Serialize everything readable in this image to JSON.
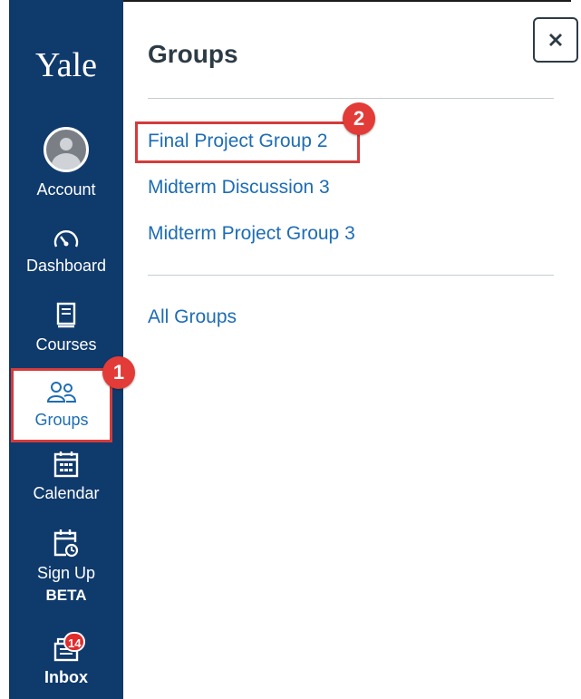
{
  "nav": {
    "logo": "Yale",
    "items": [
      {
        "label": "Account",
        "icon": "account-avatar-icon"
      },
      {
        "label": "Dashboard",
        "icon": "dashboard-icon"
      },
      {
        "label": "Courses",
        "icon": "courses-icon"
      },
      {
        "label": "Groups",
        "icon": "groups-icon",
        "active": true
      },
      {
        "label": "Calendar",
        "icon": "calendar-icon"
      },
      {
        "label_line1": "Sign Up",
        "label_line2": "BETA",
        "icon": "signup-clock-icon"
      },
      {
        "label": "Inbox",
        "icon": "inbox-icon",
        "badge": "14"
      }
    ]
  },
  "tray": {
    "title": "Groups",
    "links": [
      "Final Project Group 2",
      "Midterm Discussion 3",
      "Midterm Project Group 3"
    ],
    "all_link": "All Groups",
    "close_icon": "close-icon"
  },
  "callouts": {
    "step1": "1",
    "step2": "2"
  },
  "colors": {
    "nav_bg": "#0f3a6c",
    "link": "#1d6db4",
    "highlight": "#d43b3b",
    "badge": "#e22b2b",
    "title": "#2d3b45"
  }
}
